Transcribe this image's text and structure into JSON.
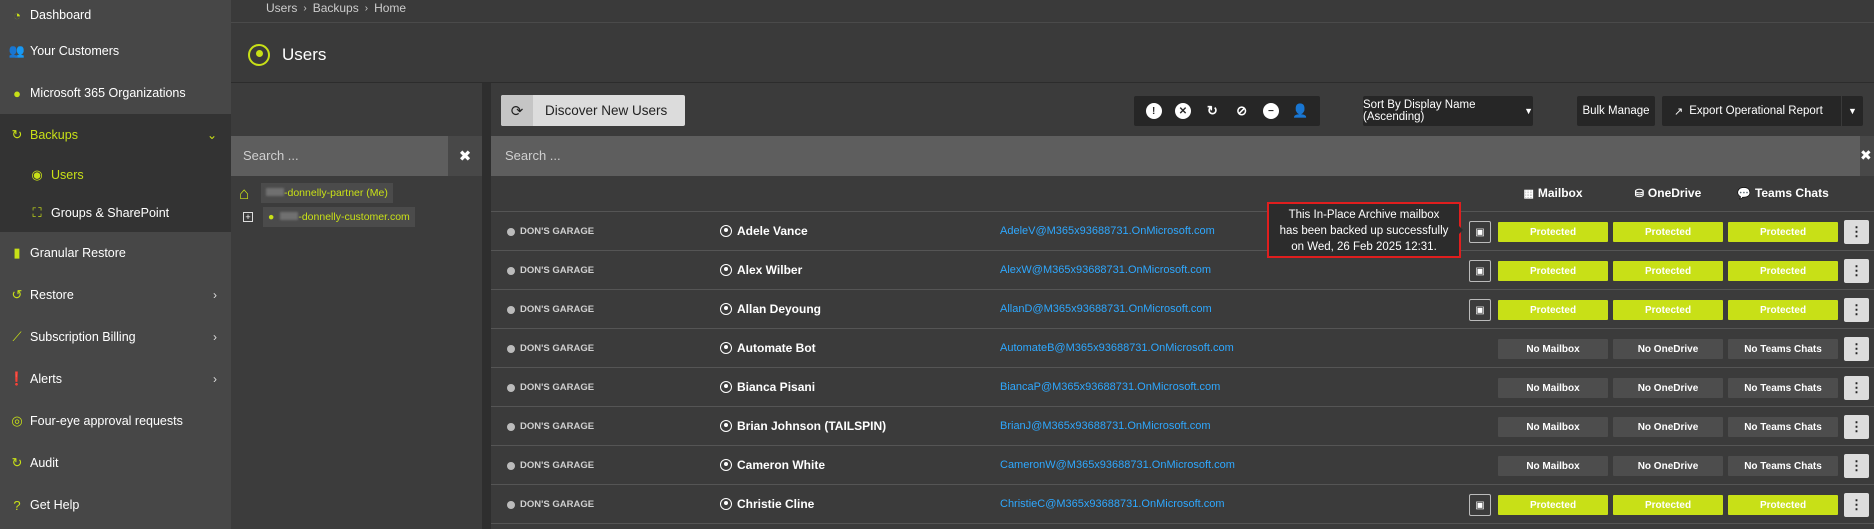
{
  "sidebar": {
    "items": [
      {
        "label": "Dashboard",
        "icon": "dashboard-icon"
      },
      {
        "label": "Your Customers",
        "icon": "users-icon"
      },
      {
        "label": "Microsoft 365 Organizations",
        "icon": "globe-icon"
      },
      {
        "label": "Backups",
        "icon": "refresh-icon"
      },
      {
        "label": "Users",
        "icon": "user-circle-icon"
      },
      {
        "label": "Groups & SharePoint",
        "icon": "sitemap-icon"
      },
      {
        "label": "Granular Restore",
        "icon": "file-icon"
      },
      {
        "label": "Restore",
        "icon": "restore-icon"
      },
      {
        "label": "Subscription Billing",
        "icon": "chart-line-icon"
      },
      {
        "label": "Alerts",
        "icon": "alert-icon"
      },
      {
        "label": "Four-eye approval requests",
        "icon": "eye-icon"
      },
      {
        "label": "Audit",
        "icon": "audit-icon"
      },
      {
        "label": "Get Help",
        "icon": "help-icon"
      }
    ]
  },
  "breadcrumb": [
    "Users",
    "Backups",
    "Home"
  ],
  "page_title": "Users",
  "tree": {
    "search_placeholder": "Search ...",
    "root_label": "-donnelly-partner (Me)",
    "child_label": "-donnelly-customer.com"
  },
  "toolbar": {
    "discover_label": "Discover New Users",
    "sort_label": "Sort By Display Name (Ascending)",
    "bulk_label": "Bulk Manage",
    "export_label": "Export Operational Report"
  },
  "main_search_placeholder": "Search ...",
  "columns": {
    "mailbox": "Mailbox",
    "onedrive": "OneDrive",
    "teams": "Teams Chats"
  },
  "rows": [
    {
      "org": "DON'S GARAGE",
      "name": "Adele Vance",
      "email": "AdeleV@M365x93688731.OnMicrosoft.com",
      "archive": true,
      "mailbox": "Protected",
      "onedrive": "Protected",
      "teams": "Protected"
    },
    {
      "org": "DON'S GARAGE",
      "name": "Alex Wilber",
      "email": "AlexW@M365x93688731.OnMicrosoft.com",
      "archive": true,
      "mailbox": "Protected",
      "onedrive": "Protected",
      "teams": "Protected"
    },
    {
      "org": "DON'S GARAGE",
      "name": "Allan Deyoung",
      "email": "AllanD@M365x93688731.OnMicrosoft.com",
      "archive": true,
      "mailbox": "Protected",
      "onedrive": "Protected",
      "teams": "Protected"
    },
    {
      "org": "DON'S GARAGE",
      "name": "Automate Bot",
      "email": "AutomateB@M365x93688731.OnMicrosoft.com",
      "archive": false,
      "mailbox": "No Mailbox",
      "onedrive": "No OneDrive",
      "teams": "No Teams Chats"
    },
    {
      "org": "DON'S GARAGE",
      "name": "Bianca Pisani",
      "email": "BiancaP@M365x93688731.OnMicrosoft.com",
      "archive": false,
      "mailbox": "No Mailbox",
      "onedrive": "No OneDrive",
      "teams": "No Teams Chats"
    },
    {
      "org": "DON'S GARAGE",
      "name": "Brian Johnson (TAILSPIN)",
      "email": "BrianJ@M365x93688731.OnMicrosoft.com",
      "archive": false,
      "mailbox": "No Mailbox",
      "onedrive": "No OneDrive",
      "teams": "No Teams Chats"
    },
    {
      "org": "DON'S GARAGE",
      "name": "Cameron White",
      "email": "CameronW@M365x93688731.OnMicrosoft.com",
      "archive": false,
      "mailbox": "No Mailbox",
      "onedrive": "No OneDrive",
      "teams": "No Teams Chats"
    },
    {
      "org": "DON'S GARAGE",
      "name": "Christie Cline",
      "email": "ChristieC@M365x93688731.OnMicrosoft.com",
      "archive": true,
      "mailbox": "Protected",
      "onedrive": "Protected",
      "teams": "Protected"
    }
  ],
  "tooltip": {
    "line1": "This In-Place Archive mailbox",
    "line2": "has been backed up successfully",
    "line3": "on Wed, 26 Feb 2025 12:31."
  },
  "colors": {
    "accent": "#c8e017",
    "link": "#2ea8ff",
    "highlight_border": "#e01e1e"
  }
}
